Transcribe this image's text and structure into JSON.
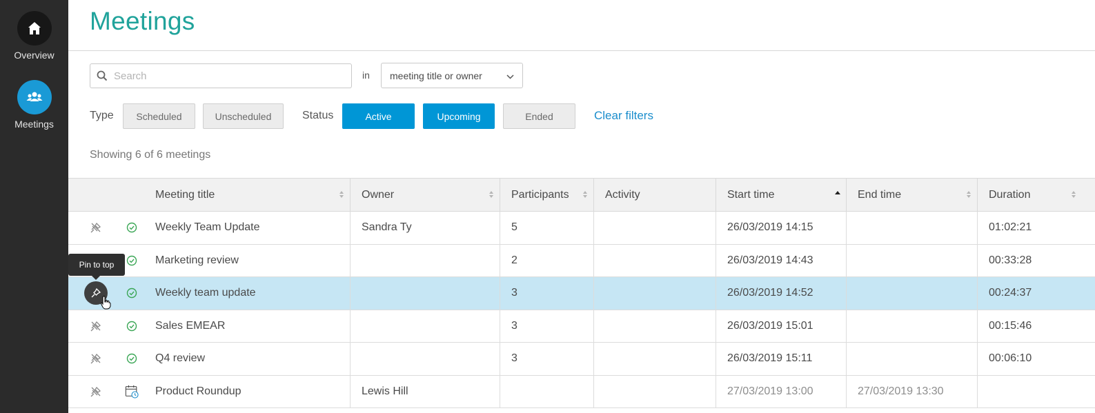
{
  "sidebar": {
    "items": [
      {
        "label": "Overview",
        "icon": "home-icon",
        "active": false
      },
      {
        "label": "Meetings",
        "icon": "people-icon",
        "active": true
      }
    ]
  },
  "header": {
    "title": "Meetings"
  },
  "search": {
    "placeholder": "Search",
    "value": "",
    "in_label": "in",
    "scope": "meeting title or owner"
  },
  "filters": {
    "type_label": "Type",
    "type_options": [
      {
        "label": "Scheduled",
        "active": false
      },
      {
        "label": "Unscheduled",
        "active": false
      }
    ],
    "status_label": "Status",
    "status_options": [
      {
        "label": "Active",
        "active": true
      },
      {
        "label": "Upcoming",
        "active": true
      },
      {
        "label": "Ended",
        "active": false
      }
    ],
    "clear_label": "Clear filters"
  },
  "results": {
    "count_text": "Showing 6 of 6 meetings"
  },
  "table": {
    "columns": [
      "Meeting title",
      "Owner",
      "Participants",
      "Activity",
      "Start time",
      "End time",
      "Duration"
    ],
    "sorted_column": "Start time",
    "sort_direction": "ascending",
    "rows": [
      {
        "title": "Weekly Team Update",
        "owner": "Sandra Ty",
        "participants": "5",
        "activity": "",
        "start": "26/03/2019 14:15",
        "end": "",
        "duration": "01:02:21",
        "status": "active"
      },
      {
        "title": "Marketing review",
        "owner": "",
        "participants": "2",
        "activity": "",
        "start": "26/03/2019 14:43",
        "end": "",
        "duration": "00:33:28",
        "status": "active"
      },
      {
        "title": "Weekly team update",
        "owner": "",
        "participants": "3",
        "activity": "",
        "start": "26/03/2019 14:52",
        "end": "",
        "duration": "00:24:37",
        "status": "active"
      },
      {
        "title": "Sales EMEAR",
        "owner": "",
        "participants": "3",
        "activity": "",
        "start": "26/03/2019 15:01",
        "end": "",
        "duration": "00:15:46",
        "status": "active"
      },
      {
        "title": "Q4 review",
        "owner": "",
        "participants": "3",
        "activity": "",
        "start": "26/03/2019 15:11",
        "end": "",
        "duration": "00:06:10",
        "status": "active"
      },
      {
        "title": "Product Roundup",
        "owner": "Lewis Hill",
        "participants": "",
        "activity": "",
        "start": "27/03/2019 13:00",
        "end": "27/03/2019 13:30",
        "duration": "",
        "status": "upcoming"
      }
    ]
  },
  "tooltip": {
    "text": "Pin to top"
  },
  "colors": {
    "accent": "#20a39b",
    "primary": "#0096d6",
    "sidebar": "#2b2b2b",
    "selected_row": "#c6e6f4",
    "status_active": "#3aa655",
    "link": "#1a8dcc"
  }
}
